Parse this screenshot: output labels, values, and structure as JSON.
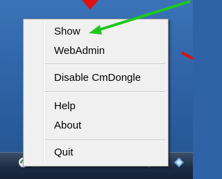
{
  "context_menu": {
    "items": [
      {
        "label": "Show"
      },
      {
        "label": "WebAdmin"
      },
      {
        "label": "Disable CmDongle"
      },
      {
        "label": "Help"
      },
      {
        "label": "About"
      },
      {
        "label": "Quit"
      }
    ]
  },
  "taskbar": {
    "tray_icons": [
      {
        "icon": "refresh-icon"
      },
      {
        "icon": "cmdongle-icon"
      },
      {
        "icon": "volume-icon"
      },
      {
        "icon": "signal-icon"
      },
      {
        "icon": "shield-icon"
      },
      {
        "icon": "flag-icon"
      },
      {
        "icon": "network-icon"
      }
    ]
  },
  "annotations": {
    "green_arrow_color": "#1ec81e",
    "red_arrow_color": "#e01010"
  }
}
